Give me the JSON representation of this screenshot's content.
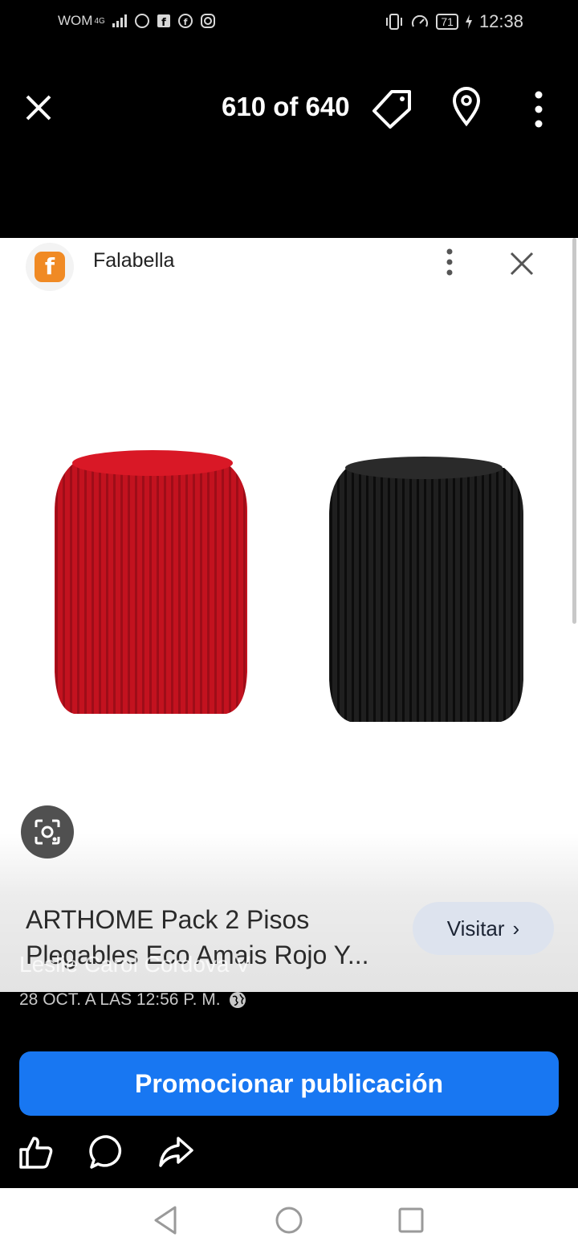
{
  "status_bar": {
    "carrier": "WOM",
    "network": "4G",
    "battery": "71",
    "time": "12:38",
    "icons": [
      "signal-icon",
      "whatsapp-icon",
      "facebook-icon",
      "facebook-icon",
      "instagram-icon",
      "vibrate-icon",
      "data-saver-icon",
      "battery-icon",
      "charging-icon"
    ]
  },
  "viewer": {
    "counter": "610 of 640",
    "icons": [
      "close-icon",
      "tag-icon",
      "location-pin-icon",
      "more-vertical-icon"
    ]
  },
  "ad": {
    "brand": "Falabella",
    "logo_letter": "f",
    "title": "ARTHOME Pack 2 Pisos Plegables Eco Amais Rojo Y...",
    "visit_label": "Visitar",
    "colors": {
      "logo": "#f08a24",
      "red_stool": "#c3121f",
      "black_stool": "#1a1a1a"
    }
  },
  "post": {
    "author": "Leslie Carol Cordova V",
    "date": "28 OCT. A LAS 12:56 P. M."
  },
  "promote_label": "Promocionar publicación",
  "actions": [
    "like-icon",
    "comment-icon",
    "share-icon"
  ],
  "nav": [
    "back-icon",
    "home-icon",
    "recents-icon"
  ],
  "accent": "#1877f2"
}
